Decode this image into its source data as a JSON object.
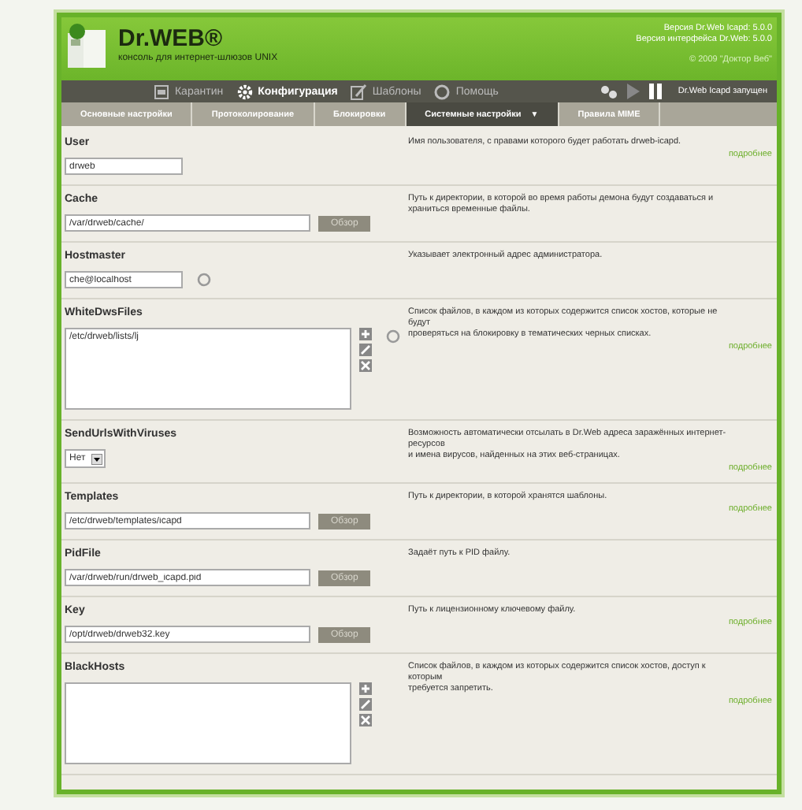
{
  "header": {
    "logo": "Dr.WEB®",
    "subtitle": "консоль для интернет-шлюзов UNIX",
    "versions": [
      "Версия Dr.Web Icapd: 5.0.0",
      "Версия интерфейса Dr.Web: 5.0.0"
    ],
    "copyright": "© 2009 \"Доктор Веб\""
  },
  "nav": {
    "items": [
      {
        "label": "Карантин",
        "selected": false
      },
      {
        "label": "Конфигурация",
        "selected": true
      },
      {
        "label": "Шаблоны",
        "selected": false
      },
      {
        "label": "Помощь",
        "selected": false
      }
    ],
    "status": "Dr.Web Icapd запущен"
  },
  "tabs": [
    {
      "label": "Основные настройки",
      "selected": false
    },
    {
      "label": "Протоколирование",
      "selected": false
    },
    {
      "label": "Блокировки",
      "selected": false
    },
    {
      "label": "Системные настройки",
      "caret": "▼",
      "selected": true
    },
    {
      "label": "Правила MIME",
      "selected": false
    }
  ],
  "rows": [
    {
      "label": "User",
      "kind": "text",
      "value": "drweb",
      "refresh": false,
      "description": [
        "Имя пользователя, с правами которого будет работать drweb-icapd."
      ],
      "more": "подробнее"
    },
    {
      "label": "Cache",
      "kind": "text",
      "value": "/var/drweb/cache/",
      "browse": "Обзор",
      "refresh": false,
      "description": [
        "Путь к директории, в которой во время работы демона будут создаваться и",
        "храниться временные файлы."
      ]
    },
    {
      "label": "Hostmaster",
      "kind": "text",
      "value": "che@localhost",
      "refresh": true,
      "description": [
        "Указывает электронный адрес администратора."
      ]
    },
    {
      "label": "WhiteDwsFiles",
      "kind": "list",
      "items": [
        "/etc/drweb/lists/lj"
      ],
      "refresh": true,
      "description": [
        "Список файлов, в каждом из которых содержится список хостов, которые не",
        "будут",
        "проверяться на блокировку в тематических черных списках."
      ],
      "more": "подробнее"
    },
    {
      "label": "SendUrlsWithViruses",
      "kind": "select",
      "value": "Нет",
      "refresh": false,
      "description": [
        "Возможность автоматически отсылать в Dr.Web адреса заражённых интернет-",
        "ресурсов",
        "и имена вирусов, найденных на этих веб-страницах."
      ],
      "more": "подробнее"
    },
    {
      "label": "Templates",
      "kind": "text",
      "value": "/etc/drweb/templates/icapd",
      "browse": "Обзор",
      "refresh": false,
      "description": [
        "Путь к директории, в которой хранятся шаблоны."
      ],
      "more": "подробнее"
    },
    {
      "label": "PidFile",
      "kind": "text",
      "value": "/var/drweb/run/drweb_icapd.pid",
      "browse": "Обзор",
      "refresh": false,
      "description": [
        "Задаёт путь к PID файлу."
      ]
    },
    {
      "label": "Key",
      "kind": "text",
      "value": "/opt/drweb/drweb32.key",
      "browse": "Обзор",
      "refresh": false,
      "description": [
        "Путь к лицензионному ключевому файлу."
      ],
      "more": "подробнее"
    },
    {
      "label": "BlackHosts",
      "kind": "list",
      "items": [],
      "refresh": false,
      "description": [
        "Список файлов, в каждом из которых содержится список хостов, доступ к",
        "которым",
        "требуется запретить."
      ],
      "more": "подробнее"
    }
  ]
}
